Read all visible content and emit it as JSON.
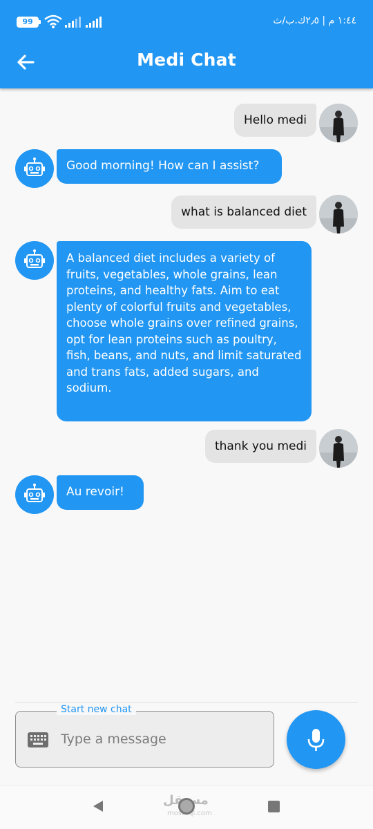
{
  "status_bar": {
    "battery": "99",
    "time": "١:٤٤ م | ٢٫٥ك.ب/ث"
  },
  "header": {
    "title": "Medi Chat",
    "back_icon": "arrow-left-icon"
  },
  "messages": [
    {
      "sender": "user",
      "text": "Hello medi"
    },
    {
      "sender": "bot",
      "text": "Good morning! How can I assist?"
    },
    {
      "sender": "user",
      "text": "what is balanced diet"
    },
    {
      "sender": "bot",
      "text": "A balanced diet includes a variety of fruits, vegetables, whole grains, lean proteins, and healthy fats. Aim to eat plenty of colorful fruits and vegetables, choose whole grains over refined grains, opt for lean proteins such as poultry, fish, beans, and nuts, and limit saturated and trans fats, added sugars, and sodium."
    },
    {
      "sender": "user",
      "text": "thank you medi"
    },
    {
      "sender": "bot",
      "text": "Au revoir!"
    }
  ],
  "composer": {
    "legend": "Start new chat",
    "placeholder": "Type a message",
    "keyboard_icon": "keyboard-icon",
    "mic_icon": "microphone-icon"
  },
  "watermark": {
    "text": "مستقل",
    "sub": "mostaql.com"
  },
  "colors": {
    "primary": "#2196f3",
    "user_bubble": "#e4e4e4",
    "background": "#f8f8f8"
  }
}
